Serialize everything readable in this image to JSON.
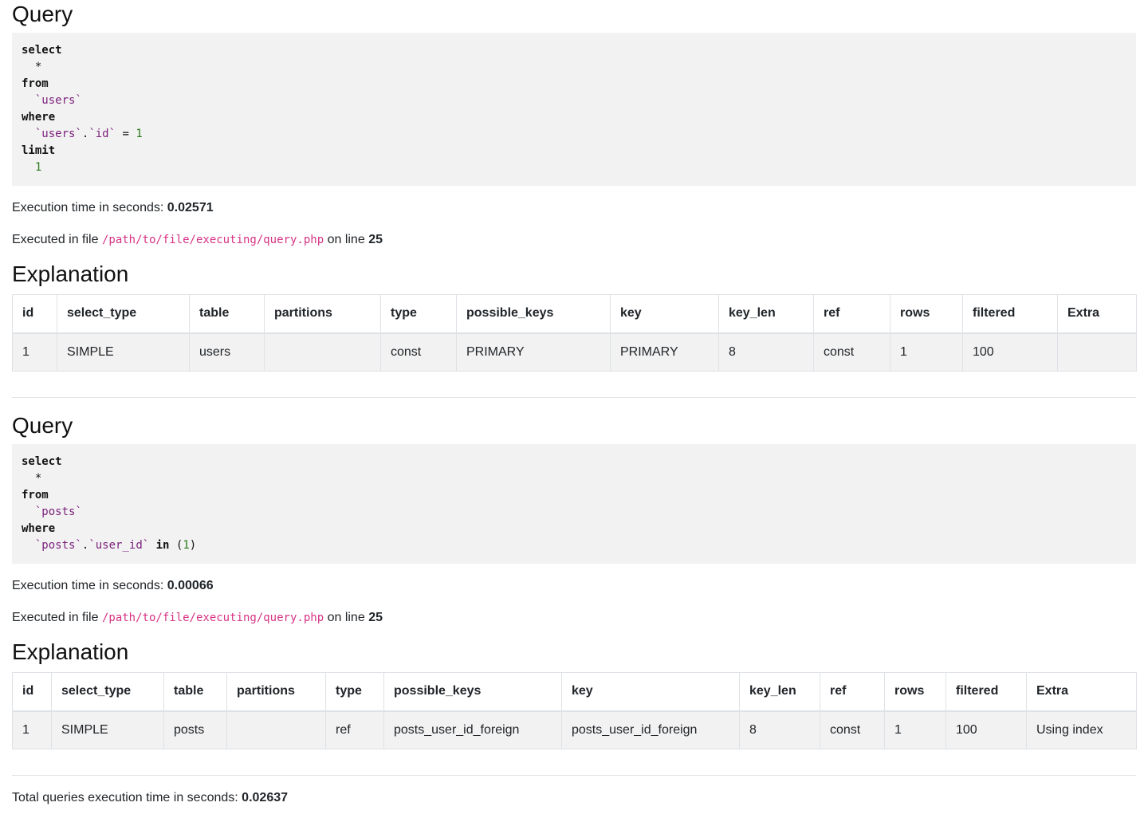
{
  "labels": {
    "query_heading": "Query",
    "explanation_heading": "Explanation",
    "exec_time_prefix": "Execution time in seconds:",
    "executed_prefix": "Executed in file",
    "on_line": "on line",
    "total_prefix": "Total queries execution time in seconds:"
  },
  "explain_columns": [
    "id",
    "select_type",
    "table",
    "partitions",
    "type",
    "possible_keys",
    "key",
    "key_len",
    "ref",
    "rows",
    "filtered",
    "Extra"
  ],
  "queries": [
    {
      "sql": {
        "select": "select",
        "star": "*",
        "from": "from",
        "table": "`users`",
        "where": "where",
        "cond_table": "`users`",
        "dot": ".",
        "cond_col": "`id`",
        "cond_op": "=",
        "cond_val": "1",
        "limit": "limit",
        "limit_val": "1"
      },
      "execution_time": "0.02571",
      "file": "/path/to/file/executing/query.php",
      "line": "25",
      "explain_row": [
        "1",
        "SIMPLE",
        "users",
        "",
        "const",
        "PRIMARY",
        "PRIMARY",
        "8",
        "const",
        "1",
        "100",
        ""
      ]
    },
    {
      "sql": {
        "select": "select",
        "star": "*",
        "from": "from",
        "table": "`posts`",
        "where": "where",
        "cond_table": "`posts`",
        "dot": ".",
        "cond_col": "`user_id`",
        "cond_op": "in",
        "paren_open": "(",
        "cond_val": "1",
        "paren_close": ")"
      },
      "execution_time": "0.00066",
      "file": "/path/to/file/executing/query.php",
      "line": "25",
      "explain_row": [
        "1",
        "SIMPLE",
        "posts",
        "",
        "ref",
        "posts_user_id_foreign",
        "posts_user_id_foreign",
        "8",
        "const",
        "1",
        "100",
        "Using index"
      ]
    }
  ],
  "total_execution_time": "0.02637"
}
